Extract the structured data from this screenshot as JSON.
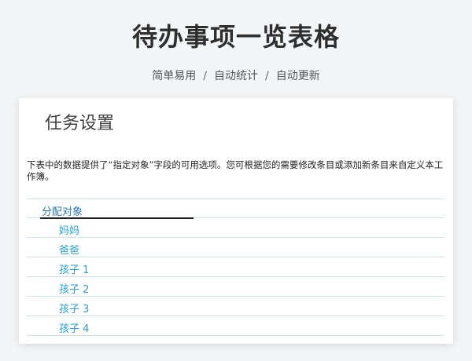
{
  "page": {
    "title": "待办事项一览表格",
    "subtitle": {
      "items": [
        "简单易用",
        "自动统计",
        "自动更新"
      ],
      "separator": "/"
    }
  },
  "sheet": {
    "title": "任务设置",
    "description": "下表中的数据提供了“指定对象”字段的可用选项。您可根据您的需要修改条目或添加新条目来自定义本工作簿。",
    "table": {
      "header": "分配对象",
      "rows": [
        "妈妈",
        "爸爸",
        "孩子 1",
        "孩子 2",
        "孩子 3",
        "孩子 4"
      ]
    }
  },
  "colors": {
    "background": "#f3f5f7",
    "card": "#ffffff",
    "header_text": "#2a7cb8",
    "row_text": "#24a3d8",
    "row_border": "#cfe3ee"
  }
}
